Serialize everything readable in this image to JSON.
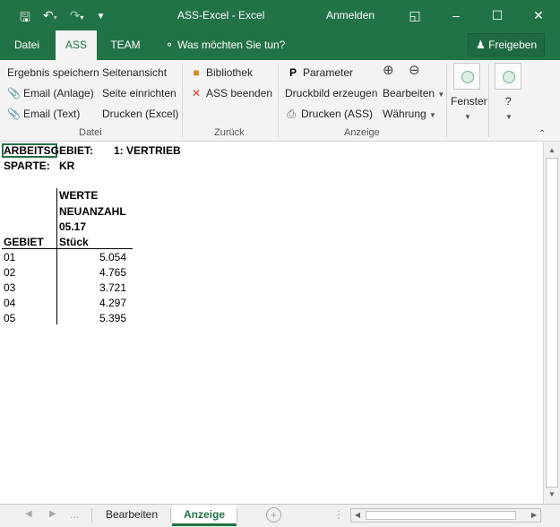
{
  "window": {
    "title": "ASS-Excel  -  Excel",
    "signin": "Anmelden",
    "save_icon": "save-icon",
    "undo_icon": "undo-icon",
    "redo_icon": "redo-icon"
  },
  "tabs": [
    {
      "label": "Datei"
    },
    {
      "label": "ASS"
    },
    {
      "label": "TEAM"
    }
  ],
  "tell_me": "Was möchten Sie tun?",
  "share": "Freigeben",
  "ribbon": {
    "datei": {
      "label": "Datei",
      "ergebnis": "Ergebnis speichern",
      "email_anlage": "Email (Anlage)",
      "email_text": "Email (Text)",
      "seitenansicht": "Seitenansicht",
      "seite_einrichten": "Seite einrichten",
      "drucken_excel": "Drucken (Excel)"
    },
    "zurueck": {
      "label": "Zurück",
      "bibliothek": "Bibliothek",
      "ass_beenden": "ASS beenden"
    },
    "anzeige": {
      "label": "Anzeige",
      "parameter": "Parameter",
      "druckbild": "Druckbild erzeugen",
      "drucken_ass": "Drucken (ASS)",
      "bearbeiten": "Bearbeiten",
      "waehrung": "Währung"
    },
    "fenster": "Fenster",
    "hilfe": "?"
  },
  "sheet": {
    "header1_label": "ARBEITSGEBIET:",
    "header1_value": "1: VERTRIEB",
    "header2_label": "SPARTE:",
    "header2_value": "KR",
    "col_gebiet": "GEBIET",
    "col_werte_1": "WERTE",
    "col_werte_2": "NEUANZAHL",
    "col_werte_3": "05.17",
    "col_werte_4": "Stück",
    "rows": [
      {
        "gebiet": "01",
        "wert": "5.054"
      },
      {
        "gebiet": "02",
        "wert": "4.765"
      },
      {
        "gebiet": "03",
        "wert": "3.721"
      },
      {
        "gebiet": "04",
        "wert": "4.297"
      },
      {
        "gebiet": "05",
        "wert": "5.395"
      }
    ]
  },
  "sheet_tabs": [
    {
      "label": "Bearbeiten"
    },
    {
      "label": "Anzeige"
    }
  ],
  "navdots": "..."
}
